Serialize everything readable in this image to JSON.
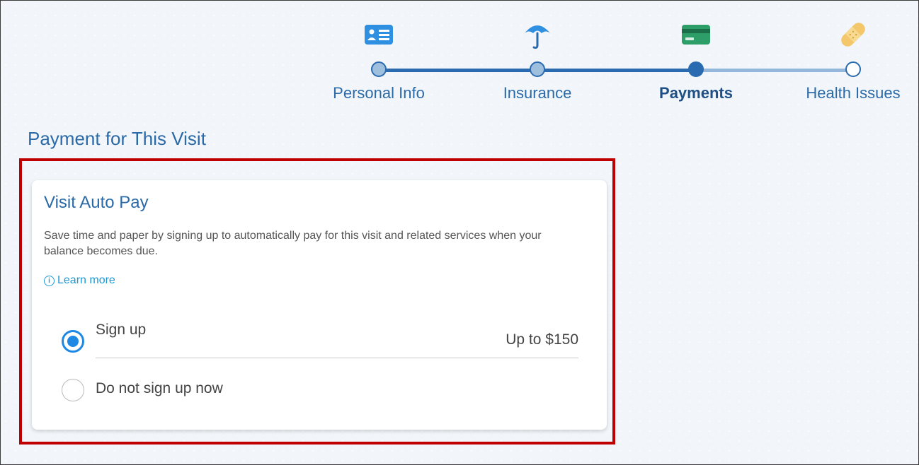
{
  "stepper": {
    "steps": [
      {
        "label": "Personal Info",
        "state": "visited",
        "icon": "id-card-icon",
        "color": "#2f8fe0"
      },
      {
        "label": "Insurance",
        "state": "visited",
        "icon": "umbrella-icon",
        "color": "#2f8fe0"
      },
      {
        "label": "Payments",
        "state": "current",
        "icon": "credit-card-icon",
        "color": "#2e9e68"
      },
      {
        "label": "Health Issues",
        "state": "future",
        "icon": "bandage-icon",
        "color": "#f0c060"
      }
    ]
  },
  "page": {
    "section_title": "Payment for This Visit"
  },
  "card": {
    "title": "Visit Auto Pay",
    "description": "Save time and paper by signing up to automatically pay for this visit and related services when your balance becomes due.",
    "learn_more_icon": "i",
    "learn_more": "Learn more",
    "options": [
      {
        "label": "Sign up",
        "amount": "Up to $150",
        "selected": true
      },
      {
        "label": "Do not sign up now",
        "selected": false
      }
    ]
  },
  "colors": {
    "accent": "#2b6aa8",
    "highlight_border": "#c00000",
    "radio_selected": "#1e88e5",
    "link": "#1b9ad6"
  }
}
